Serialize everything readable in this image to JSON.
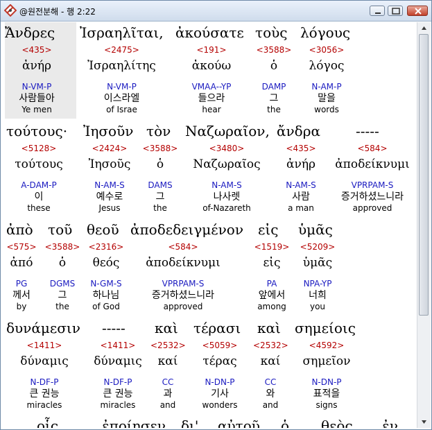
{
  "window": {
    "title": "@원전분해 - 행 2:22"
  },
  "lines": [
    {
      "words": [
        {
          "greek": "Ἄνδρες",
          "strong": "<435>",
          "lemma": "ἀνήρ",
          "parse": "N-VM-P",
          "korean": "사람들아",
          "english": "Ye men"
        },
        {
          "greek": "Ἰσραηλῖται,",
          "strong": "<2475>",
          "lemma": "Ἰσραηλίτης",
          "parse": "N-VM-P",
          "korean": "이스라엘",
          "english": "of Israe"
        },
        {
          "greek": "ἀκούσατε",
          "strong": "<191>",
          "lemma": "ἀκούω",
          "parse": "VMAA--YP",
          "korean": "들으라",
          "english": "hear"
        },
        {
          "greek": "τοὺς",
          "strong": "<3588>",
          "lemma": "ὁ",
          "parse": "DAMP",
          "korean": "그",
          "english": "the"
        },
        {
          "greek": "λόγους",
          "strong": "<3056>",
          "lemma": "λόγος",
          "parse": "N-AM-P",
          "korean": "말을",
          "english": "words"
        }
      ]
    },
    {
      "words": [
        {
          "greek": "τούτους·",
          "strong": "<5128>",
          "lemma": "τούτους",
          "parse": "A-DAM-P",
          "korean": "이",
          "english": "these"
        },
        {
          "greek": "Ἰησοῦν",
          "strong": "<2424>",
          "lemma": "Ἰησοῦς",
          "parse": "N-AM-S",
          "korean": "예수로",
          "english": "Jesus"
        },
        {
          "greek": "τὸν",
          "strong": "<3588>",
          "lemma": "ὁ",
          "parse": "DAMS",
          "korean": "그",
          "english": "the"
        },
        {
          "greek": "Ναζωραῖον,",
          "strong": "<3480>",
          "lemma": "Ναζωραῖος",
          "parse": "N-AM-S",
          "korean": "나사렛",
          "english": "of-Nazareth"
        },
        {
          "greek": "ἄνδρα",
          "strong": "<435>",
          "lemma": "ἀνήρ",
          "parse": "N-AM-S",
          "korean": "사람",
          "english": "a man"
        },
        {
          "greek": "-----",
          "strong": "<584>",
          "lemma": "ἀποδείκνυμι",
          "parse": "VPRPAM-S",
          "korean": "증거하셨느니라",
          "english": "approved"
        }
      ]
    },
    {
      "words": [
        {
          "greek": "ἀπὸ",
          "strong": "<575>",
          "lemma": "ἀπό",
          "parse": "PG",
          "korean": "께서",
          "english": "by"
        },
        {
          "greek": "τοῦ",
          "strong": "<3588>",
          "lemma": "ὁ",
          "parse": "DGMS",
          "korean": "그",
          "english": "the"
        },
        {
          "greek": "θεοῦ",
          "strong": "<2316>",
          "lemma": "θεός",
          "parse": "N-GM-S",
          "korean": "하나님",
          "english": "of God"
        },
        {
          "greek": "ἀποδεδειγμένον",
          "strong": "<584>",
          "lemma": "ἀποδείκνυμι",
          "parse": "VPRPAM-S",
          "korean": "증거하셨느니라",
          "english": "approved"
        },
        {
          "greek": "εἰς",
          "strong": "<1519>",
          "lemma": "εἰς",
          "parse": "PA",
          "korean": "앞에서",
          "english": "among"
        },
        {
          "greek": "ὑμᾶς",
          "strong": "<5209>",
          "lemma": "ὑμᾶς",
          "parse": "NPA-YP",
          "korean": "너희",
          "english": "you"
        }
      ]
    },
    {
      "words": [
        {
          "greek": "δυνάμεσιν",
          "strong": "<1411>",
          "lemma": "δύναμις",
          "parse": "N-DF-P",
          "korean": "큰 권능",
          "english": "miracles"
        },
        {
          "greek": "-----",
          "strong": "<1411>",
          "lemma": "δύναμις",
          "parse": "N-DF-P",
          "korean": "큰 권능",
          "english": "miracles"
        },
        {
          "greek": "καὶ",
          "strong": "<2532>",
          "lemma": "καί",
          "parse": "CC",
          "korean": "과",
          "english": "and"
        },
        {
          "greek": "τέρασι",
          "strong": "<5059>",
          "lemma": "τέρας",
          "parse": "N-DN-P",
          "korean": "기사",
          "english": "wonders"
        },
        {
          "greek": "καὶ",
          "strong": "<2532>",
          "lemma": "καί",
          "parse": "CC",
          "korean": "와",
          "english": "and"
        },
        {
          "greek": "σημείοις",
          "strong": "<4592>",
          "lemma": "σημεῖον",
          "parse": "N-DN-P",
          "korean": "표적을",
          "english": "signs"
        }
      ]
    },
    {
      "words": [
        {
          "greek": "οἷς"
        },
        {
          "greek": "ἐποίησεν"
        },
        {
          "greek": "δι'"
        },
        {
          "greek": "αὐτοῦ"
        },
        {
          "greek": "ὁ"
        },
        {
          "greek": "θεὸς"
        },
        {
          "greek": "ἐν"
        }
      ]
    }
  ],
  "colors": {
    "strong": "#b40000",
    "parse": "#1a1ac0",
    "highlight": "#eaeaea"
  },
  "icons": [
    "app-icon",
    "minimize-icon",
    "maximize-icon",
    "close-icon",
    "scroll-up-icon",
    "scroll-down-icon"
  ]
}
